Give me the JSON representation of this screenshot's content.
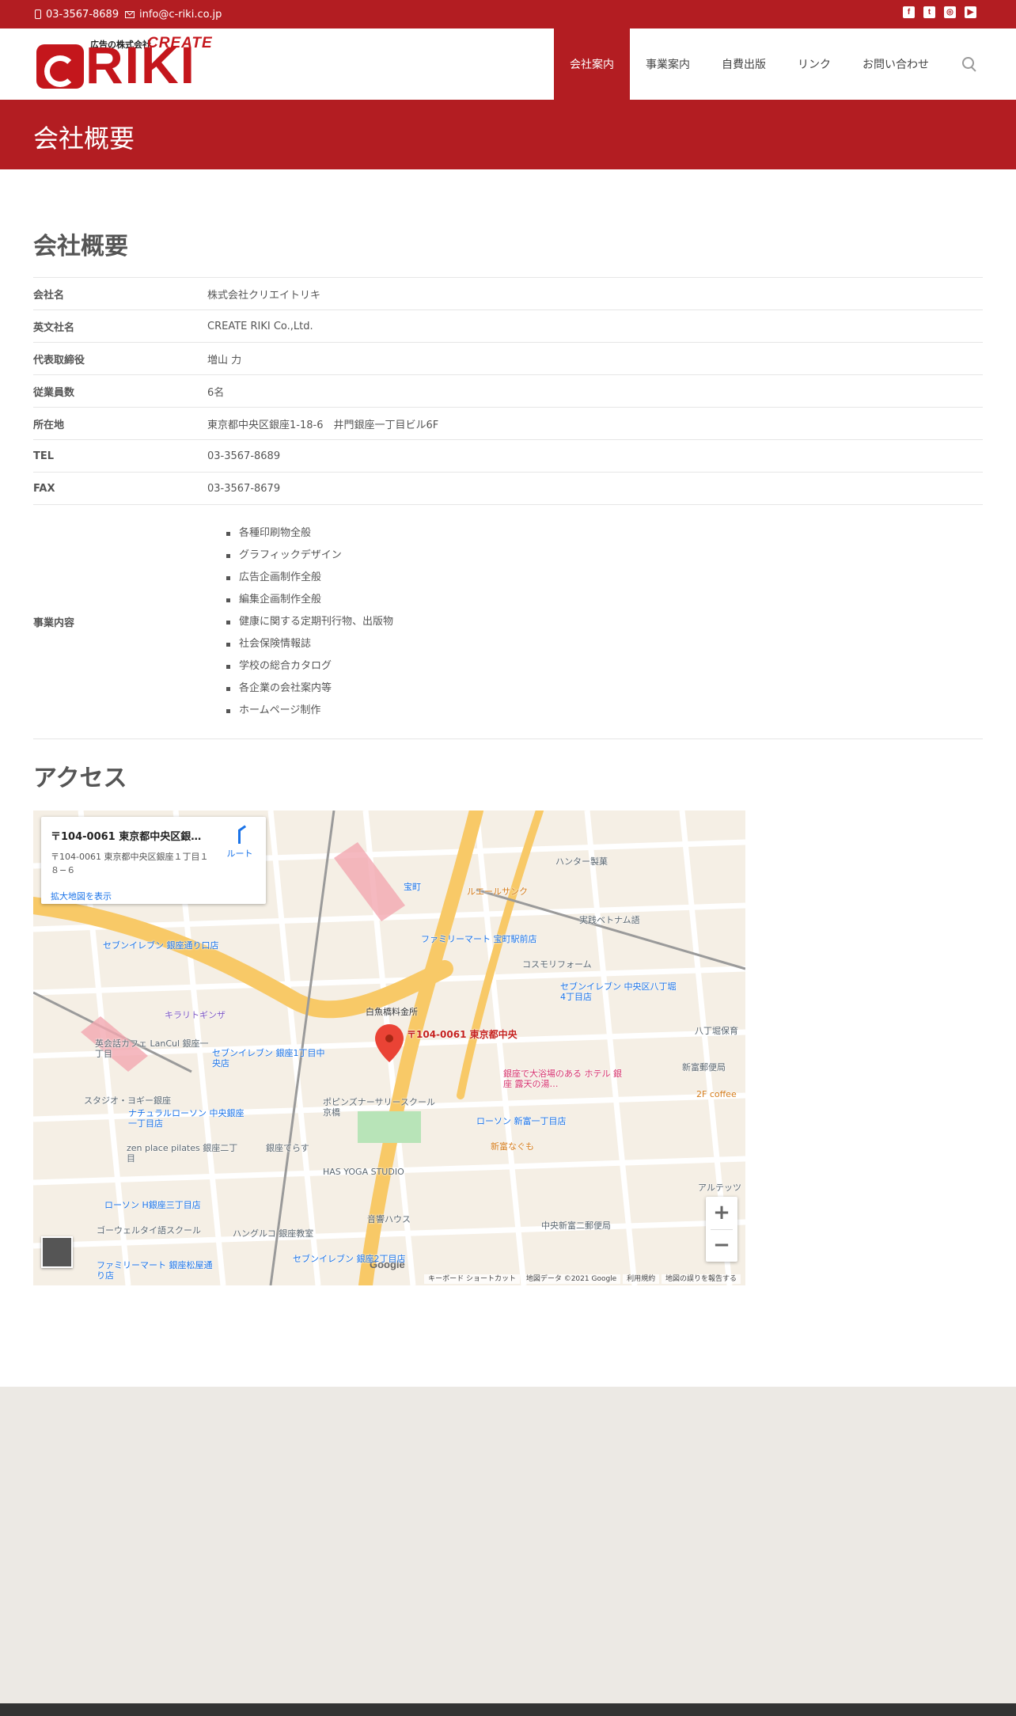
{
  "topbar": {
    "phone": "03-3567-8689",
    "email": "info@c-riki.co.jp",
    "social": [
      "facebook",
      "twitter",
      "instagram",
      "youtube"
    ],
    "accent_color": "#b31d22"
  },
  "header": {
    "logo": {
      "sub": "広告の株式会社",
      "create": "CREATE",
      "riki": "RIKI"
    },
    "nav": [
      {
        "label": "会社案内",
        "active": true
      },
      {
        "label": "事業案内",
        "active": false
      },
      {
        "label": "自費出版",
        "active": false
      },
      {
        "label": "リンク",
        "active": false
      },
      {
        "label": "お問い合わせ",
        "active": false
      }
    ]
  },
  "page_title": "会社概要",
  "company": {
    "heading": "会社概要",
    "rows": [
      {
        "key": "会社名",
        "value": "株式会社クリエイトリキ"
      },
      {
        "key": "英文社名",
        "value": "CREATE RIKI Co.,Ltd."
      },
      {
        "key": "代表取締役",
        "value": "増山 力"
      },
      {
        "key": "従業員数",
        "value": "6名"
      },
      {
        "key": "所在地",
        "value": "東京都中央区銀座1-18-6　井門銀座一丁目ビル6F"
      },
      {
        "key": "TEL",
        "value": "03-3567-8689"
      },
      {
        "key": "FAX",
        "value": "03-3567-8679"
      }
    ],
    "business": {
      "key": "事業内容",
      "items": [
        "各種印刷物全般",
        "グラフィックデザイン",
        "広告企画制作全般",
        "編集企画制作全般",
        "健康に関する定期刊行物、出版物",
        "社会保険情報誌",
        "学校の総合カタログ",
        "各企業の会社案内等",
        "ホームページ制作"
      ]
    }
  },
  "access": {
    "heading": "アクセス",
    "map": {
      "card_title": "〒104-0061 東京都中央区銀座…",
      "card_address": "〒104-0061 東京都中央区銀座１丁目１８−６",
      "route_label": "ルート",
      "enlarge_link": "拡大地図を表示",
      "pin_label": "〒104-0061 東京都中央",
      "google": "Google",
      "attribution": [
        "キーボード ショートカット",
        "地図データ ©2021 Google",
        "利用規約",
        "地図の誤りを報告する"
      ],
      "zoom_in": "+",
      "zoom_out": "−",
      "labels": [
        "ハンター製菓",
        "ルエールサンク",
        "宝町",
        "実践ベトナム語",
        "セブンイレブン 銀座通り口店",
        "キラリトギンザ",
        "英会話カフェ LanCul 銀座一丁目",
        "セブンイレブン 銀座1丁目中央店",
        "スタジオ・ヨギー銀座",
        "ナチュラルローソン 中央銀座一丁目店",
        "ポピンズナーサリースクール京橋",
        "ローソン 新富一丁目店",
        "新富なぐも",
        "HAS YOGA STUDIO",
        "銀座てらす",
        "zen place pilates 銀座二丁目",
        "ローソン H銀座三丁目店",
        "ゴーウェルタイ語スクール",
        "ハングルコ 銀座教室",
        "セブンイレブン 銀座2丁目店",
        "ファミリーマート 銀座松屋通り店",
        "中央新富二郵便局",
        "八丁堀保育",
        "新富郵便局",
        "2F coffee",
        "白魚橋料金所",
        "ファミリーマート 宝町駅前店",
        "セブンイレブン 中央区八丁堀4丁目店",
        "コスモリフォーム",
        "音響ハウス",
        "銀座で大浴場のある ホテル 銀座 露天の湯…",
        "アルテッツ"
      ]
    }
  }
}
